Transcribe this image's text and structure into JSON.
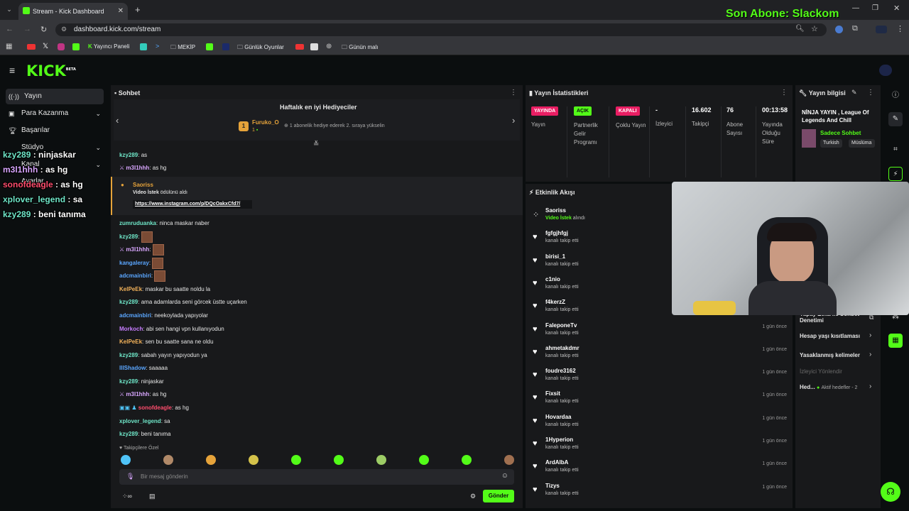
{
  "overlay_top": "Son Abone: Slackom",
  "browser": {
    "tab_title": "Stream - Kick Dashboard",
    "url": "dashboard.kick.com/stream",
    "bookmarks": [
      "Yayıncı Paneli",
      "MEKİP",
      "Günlük Oyunlar",
      "Günün malı"
    ]
  },
  "brand": {
    "logo": "KICK",
    "beta": "BETA"
  },
  "sidebar": {
    "items": [
      "Yayın",
      "Para Kazanma",
      "Başarılar",
      "Stüdyo",
      "Kanal",
      "Ayarlar"
    ]
  },
  "overlay_chat": [
    {
      "user": "kzy289",
      "msg": " : ninjaskar"
    },
    {
      "user": "m3l1hhh",
      "msg": " : as hg"
    },
    {
      "user": "sonofdeagle",
      "msg": " : as hg"
    },
    {
      "user": "xplover_legend",
      "msg": " : sa"
    },
    {
      "user": "kzy289",
      "msg": " : beni tanıma"
    }
  ],
  "chat": {
    "title": "Sohbet",
    "top_gifters_title": "Haftalık en iyi Hediyeciler",
    "gifter_name": "Furuko_O",
    "gifter_count": "1",
    "gifter_hint": "1 abonelik hediye ederek 2. sıraya yükselin",
    "reward": {
      "user": "Saoriss",
      "reward_name": "Video İstek",
      "reward_text": " ödülünü aldı",
      "link": "https://www.instagram.com/p/DQcOakxCfd7/"
    },
    "lines": [
      {
        "user": "kzy289",
        "msg": "as"
      },
      {
        "user": "m3l1hhh",
        "msg": "as hg"
      },
      {
        "user": "zumruduanka",
        "msg": "ninca maskar naber"
      },
      {
        "user": "kzy289",
        "msg": ""
      },
      {
        "user": "m3l1hhh",
        "msg": ""
      },
      {
        "user": "kangaleray",
        "msg": ""
      },
      {
        "user": "adcmainbiri",
        "msg": ""
      },
      {
        "user": "KelPeEk",
        "msg": "maskar bu saatte noldu la"
      },
      {
        "user": "kzy289",
        "msg": "ama adamlarda seni görcek üstte uçarken"
      },
      {
        "user": "adcmainbiri",
        "msg": "neekoylada yapıyolar"
      },
      {
        "user": "Morkoch",
        "msg": "abi sen hangi vpn kullanıyodun"
      },
      {
        "user": "KelPeEk",
        "msg": "sen bu saatte sana ne oldu"
      },
      {
        "user": "kzy289",
        "msg": "sabah yayın yapıyodun ya"
      },
      {
        "user": "lllShadow",
        "msg": "saaaaa"
      },
      {
        "user": "kzy289",
        "msg": "ninjaskar"
      },
      {
        "user": "m3l1hhh",
        "msg": "as hg"
      },
      {
        "user": "sonofdeagle",
        "msg": "as hg"
      },
      {
        "user": "xplover_legend",
        "msg": "sa"
      },
      {
        "user": "kzy289",
        "msg": "beni tanıma"
      }
    ],
    "followers_only": "Takipçilere Özel",
    "input_placeholder": "Bir mesaj gönderin",
    "send_label": "Gönder"
  },
  "stats": {
    "title": "Yayın İstatistikleri",
    "columns": [
      {
        "badge": "YAYINDA",
        "label": "Yayın",
        "color": "#e91e63"
      },
      {
        "badge": "AÇIK",
        "label": "Partnerlik Gelir Programı",
        "color": "#53fc18"
      },
      {
        "badge": "KAPALI",
        "label": "Çoklu Yayın",
        "color": "#e91e63"
      },
      {
        "value": "-",
        "label": "İzleyici"
      },
      {
        "value": "16.602",
        "label": "Takipçi"
      },
      {
        "value": "76",
        "label": "Abone Sayısı"
      },
      {
        "value": "00:13:58",
        "label": "Yayında Olduğu Süre"
      }
    ]
  },
  "activity": {
    "title": "Etkinlik Akışı",
    "items": [
      {
        "name": "Saoriss",
        "sub": "Video İstek alındı",
        "time": ""
      },
      {
        "name": "fgfgjhfgj",
        "sub": "kanalı takip etti",
        "time": ""
      },
      {
        "name": "birisi_1",
        "sub": "kanalı takip etti",
        "time": ""
      },
      {
        "name": "c1nio",
        "sub": "kanalı takip etti",
        "time": ""
      },
      {
        "name": "f4kerzZ",
        "sub": "kanalı takip etti",
        "time": ""
      },
      {
        "name": "FaleponeTv",
        "sub": "kanalı takip etti",
        "time": "1 gün önce"
      },
      {
        "name": "ahmetakdmr",
        "sub": "kanalı takip etti",
        "time": "1 gün önce"
      },
      {
        "name": "foudre3162",
        "sub": "kanalı takip etti",
        "time": "1 gün önce"
      },
      {
        "name": "Fixsit",
        "sub": "kanalı takip etti",
        "time": "1 gün önce"
      },
      {
        "name": "Hovardaa",
        "sub": "kanalı takip etti",
        "time": "1 gün önce"
      },
      {
        "name": "1Hyperion",
        "sub": "kanalı takip etti",
        "time": "1 gün önce"
      },
      {
        "name": "ArdAlbA",
        "sub": "kanalı takip etti",
        "time": "1 gün önce"
      },
      {
        "name": "Tizys",
        "sub": "kanalı takip etti",
        "time": "1 gün önce"
      }
    ]
  },
  "stream_info": {
    "title": "Yayın bilgisi",
    "stream_title": "NİNJA YAYIN , League Of Legends And Chill",
    "category": "Sadece Sohbet",
    "tags": [
      "Turkish",
      "Müslüma"
    ]
  },
  "moderation": {
    "items": [
      "Yapay Zeka ile Sohbet Denetimi",
      "Hesap yaşı kısıtlaması",
      "Yasaklanmış kelimeler",
      "İzleyici Yönlendir"
    ],
    "goals_label": "Hed...",
    "goals_value": "Aktif hedefler - 2"
  }
}
